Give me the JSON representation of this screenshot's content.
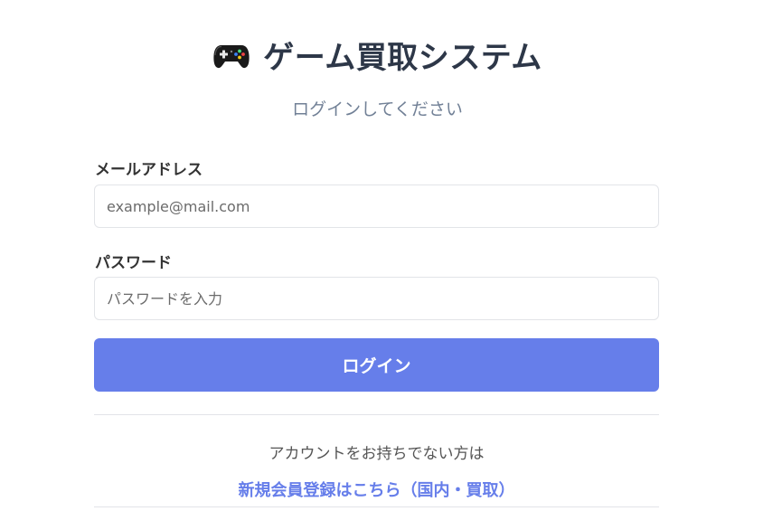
{
  "header": {
    "icon": "game-controller-icon",
    "title": "ゲーム買取システム",
    "subtitle": "ログインしてください"
  },
  "form": {
    "email_label": "メールアドレス",
    "email_placeholder": "example@mail.com",
    "email_value": "",
    "password_label": "パスワード",
    "password_placeholder": "パスワードを入力",
    "password_value": "",
    "login_label": "ログイン"
  },
  "footer": {
    "no_account_text": "アカウントをお持ちでない方は",
    "register_link": "新規会員登録はこちら（国内・買取）"
  },
  "colors": {
    "accent": "#667eea",
    "title": "#2d3748",
    "subtitle": "#718096",
    "border": "#e2e4e8"
  }
}
